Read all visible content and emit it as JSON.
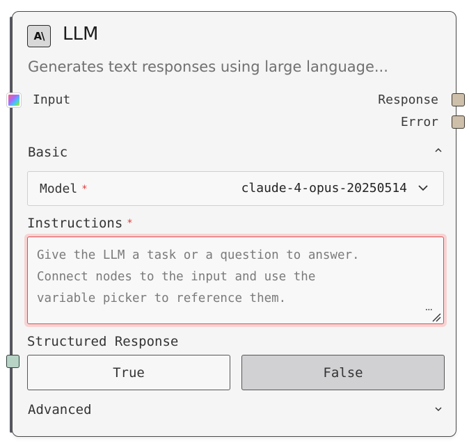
{
  "node": {
    "logo_text": "A\\",
    "title": "LLM",
    "description": "Generates text responses using large language..."
  },
  "ports": {
    "input_label": "Input",
    "response_label": "Response",
    "error_label": "Error"
  },
  "basic": {
    "title": "Basic",
    "model": {
      "label": "Model",
      "required_mark": "*",
      "value": "claude-4-opus-20250514"
    },
    "instructions": {
      "label": "Instructions",
      "required_mark": "*",
      "placeholder": "Give the LLM a task or a question to answer.\nConnect nodes to the input and use the\nvariable picker to reference them.",
      "menu_glyph": "..."
    },
    "structured_response": {
      "label": "Structured Response",
      "true_label": "True",
      "false_label": "False",
      "selected": "False"
    }
  },
  "advanced": {
    "title": "Advanced"
  },
  "icons": {
    "collapse": "chevron-up-icon",
    "expand": "chevron-down-icon",
    "select": "chevron-down-icon",
    "more": "ellipsis-icon",
    "resize": "resize-handle-icon"
  },
  "colors": {
    "error_border": "#e24b4b",
    "required": "#e03a3a",
    "selected_toggle": "#d1d1d4",
    "output_port": "#cdbfaa",
    "structured_port": "#b7d3c6"
  }
}
